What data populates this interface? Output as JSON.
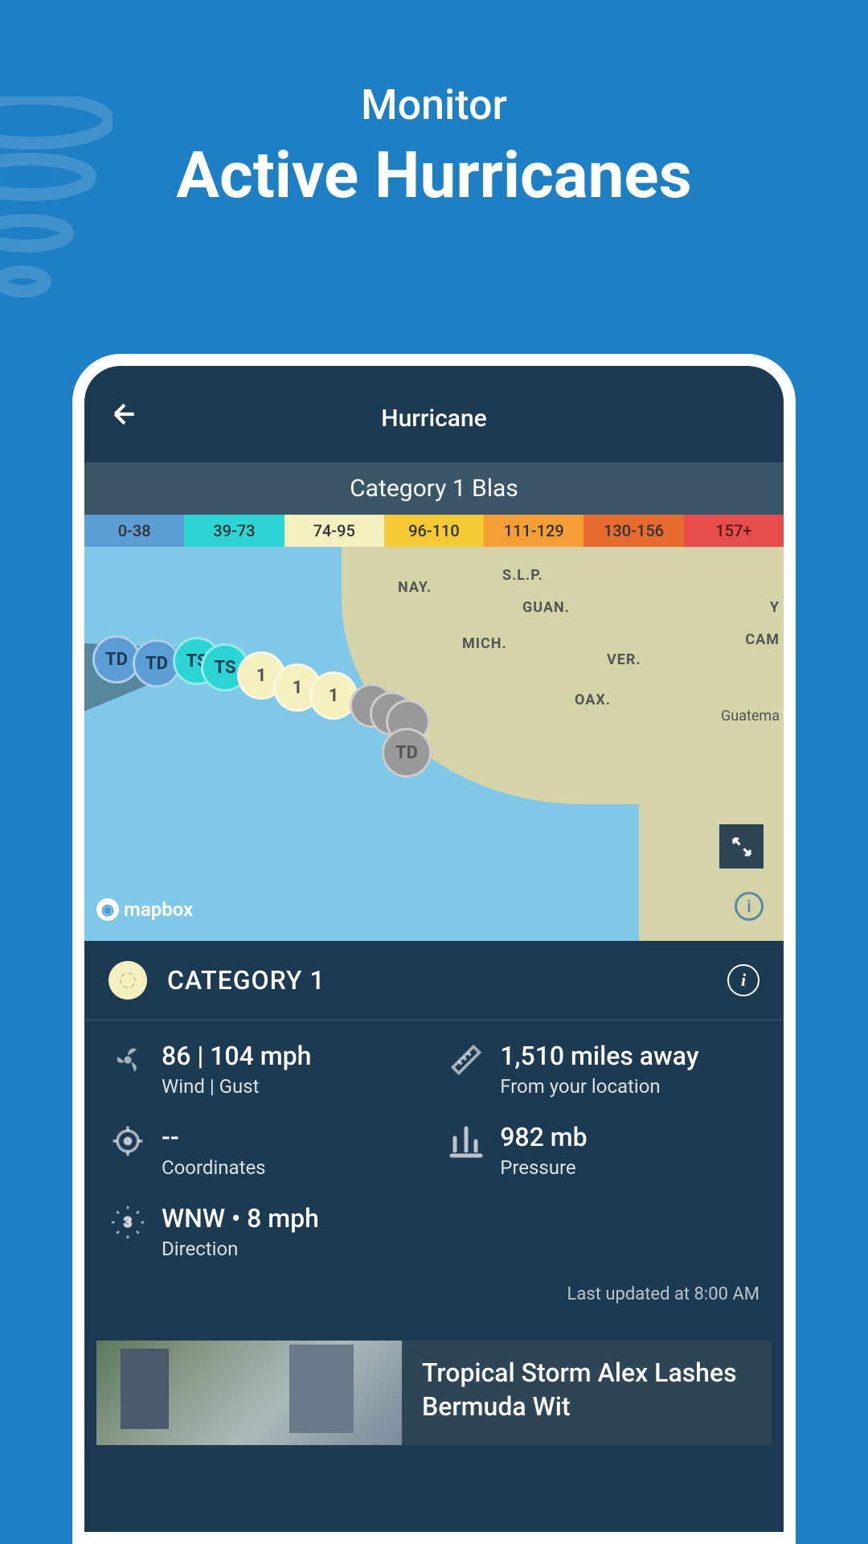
{
  "header": {
    "subtitle": "Monitor",
    "title": "Active Hurricanes"
  },
  "app": {
    "title": "Hurricane",
    "storm_name": "Category 1 Blas"
  },
  "scale": [
    {
      "range": "0-38",
      "color": "#5d9dd5"
    },
    {
      "range": "39-73",
      "color": "#2dd4d4"
    },
    {
      "range": "74-95",
      "color": "#f5f0c0"
    },
    {
      "range": "96-110",
      "color": "#f5c935"
    },
    {
      "range": "111-129",
      "color": "#f59e35"
    },
    {
      "range": "130-156",
      "color": "#e66b2e"
    },
    {
      "range": "157+",
      "color": "#e84d4d"
    }
  ],
  "map": {
    "labels": {
      "nay": "NAY.",
      "slp": "S.L.P.",
      "guan": "GUAN.",
      "mich": "MICH.",
      "ver": "VER.",
      "oax": "OAX.",
      "cam": "CAM",
      "guat": "Guatema",
      "y": "Y"
    },
    "attribution": "mapbox",
    "markers": {
      "td": "TD",
      "ts": "TS",
      "cat1": "1"
    }
  },
  "category": {
    "label": "CATEGORY 1"
  },
  "stats": {
    "wind": {
      "value": "86 | 104 mph",
      "label": "Wind | Gust"
    },
    "distance": {
      "value": "1,510 miles away",
      "label": "From your location"
    },
    "coords": {
      "value": "--",
      "label": "Coordinates"
    },
    "pressure": {
      "value": "982 mb",
      "label": "Pressure"
    },
    "direction": {
      "value": "WNW • 8 mph",
      "label": "Direction"
    }
  },
  "updated": "Last updated at 8:00 AM",
  "news": {
    "title": "Tropical Storm Alex Lashes Bermuda Wit"
  }
}
